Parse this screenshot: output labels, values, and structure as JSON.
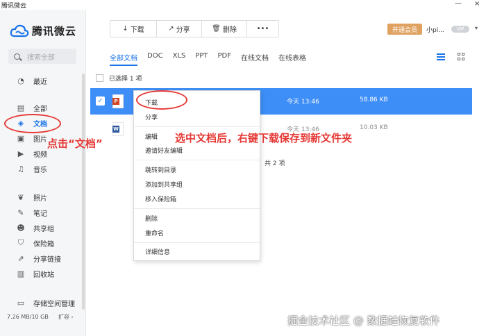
{
  "window": {
    "title": "腾讯微云",
    "controls": [
      "—",
      "×"
    ]
  },
  "logo": {
    "text": "腾讯微云"
  },
  "search": {
    "placeholder": "搜索全部"
  },
  "sidebar": {
    "items": [
      {
        "label": "最近",
        "icon": "clock-icon"
      },
      {
        "label": "全部",
        "icon": "file-icon"
      },
      {
        "label": "文档",
        "icon": "layers-icon",
        "active": true
      },
      {
        "label": "图片",
        "icon": "image-icon"
      },
      {
        "label": "视频",
        "icon": "play-icon"
      },
      {
        "label": "音乐",
        "icon": "music-icon"
      },
      {
        "label": "照片",
        "icon": "leaf-icon"
      },
      {
        "label": "笔记",
        "icon": "pen-icon"
      },
      {
        "label": "共享组",
        "icon": "users-icon"
      },
      {
        "label": "保险箱",
        "icon": "shield-icon"
      },
      {
        "label": "分享链接",
        "icon": "share-link-icon"
      },
      {
        "label": "回收站",
        "icon": "trash-icon"
      },
      {
        "label": "存储空间管理",
        "icon": "storage-icon"
      }
    ],
    "storage": "7.26 MB/10 GB",
    "expand": "扩容 ›"
  },
  "toolbar": {
    "download": "下载",
    "share": "分享",
    "delete": "删除",
    "more": "•••",
    "icons": {
      "download": "↓",
      "share": "↗",
      "delete": "🗑"
    }
  },
  "account": {
    "vip_button": "开通会员",
    "username": "小pi...",
    "badge": "VIP",
    "caret": "▾"
  },
  "filters": [
    "全部文档",
    "DOC",
    "XLS",
    "PPT",
    "PDF",
    "在线文档",
    "在线表格"
  ],
  "selection": {
    "text": "已选择 1 项"
  },
  "files": [
    {
      "type": "P",
      "time": "今天 13:46",
      "size": "58.86 KB",
      "selected": true
    },
    {
      "type": "W",
      "time": "今天 13:46",
      "size": "10.03 KB",
      "selected": false
    }
  ],
  "total": "共 2 项",
  "context_menu": {
    "items": [
      "下载",
      "分享",
      "编辑",
      "邀请好友编辑",
      "跳转到目录",
      "添加到共享组",
      "移入保险箱",
      "删除",
      "重命名",
      "详细信息"
    ]
  },
  "annotations": {
    "click_doc": "点击“文档”",
    "instruction": "选中文档后，右键下载保存到新文件夹"
  },
  "watermark": "掘金技术社区 @ 数据蛙恢复软件",
  "colors": {
    "accent": "#1a73e8",
    "selected_row": "#3e8ef7",
    "annotation": "#e53935",
    "vip": "#e0a261"
  }
}
